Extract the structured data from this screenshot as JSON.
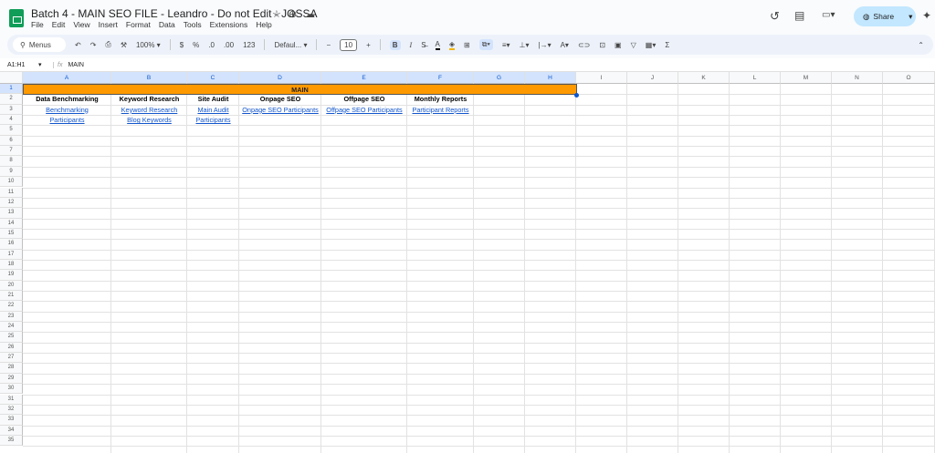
{
  "doc": {
    "title": "Batch 4 - MAIN SEO FILE - Leandro - Do not Edit - JOSSA"
  },
  "menu": [
    "File",
    "Edit",
    "View",
    "Insert",
    "Format",
    "Data",
    "Tools",
    "Extensions",
    "Help"
  ],
  "toolbar": {
    "search": "Menus",
    "zoom": "100%",
    "currency": "$",
    "percent": "%",
    "dec_dec": ".0",
    "inc_dec": ".00",
    "num_format": "123",
    "font": "Defaul...",
    "font_size": "10",
    "bold": "B",
    "italic": "I"
  },
  "share": {
    "label": "Share"
  },
  "formula_bar": {
    "name_box": "A1:H1",
    "fx": "fx",
    "value": "MAIN"
  },
  "colors": {
    "header_fill": "#ff9900",
    "link": "#1155cc",
    "accent": "#0b57d0"
  },
  "columns": [
    "A",
    "B",
    "C",
    "D",
    "E",
    "F",
    "G",
    "H",
    "I",
    "J",
    "K",
    "L",
    "M",
    "N",
    "O"
  ],
  "rows": [
    "1",
    "2",
    "3",
    "4",
    "5",
    "6",
    "7",
    "8",
    "9",
    "10",
    "11",
    "12",
    "13",
    "14",
    "15",
    "16",
    "17",
    "18",
    "19",
    "20",
    "21",
    "22",
    "23",
    "24",
    "25",
    "26",
    "27",
    "28",
    "29",
    "30",
    "31",
    "32",
    "33",
    "34",
    "35"
  ],
  "sheet": {
    "merged_header": "MAIN",
    "headers": [
      "Data Benchmarking",
      "Keyword Research",
      "Site Audit",
      "Onpage SEO",
      "Offpage SEO",
      "Monthly Reports"
    ],
    "row3": [
      "Benchmarking",
      "Keyword Research",
      "Main Audit",
      "Onpage SEO Participants",
      "Offpage SEO Participants",
      "Participant Reports"
    ],
    "row4": [
      "Participants",
      "Blog Keywords",
      "Participants",
      "",
      "",
      ""
    ]
  }
}
